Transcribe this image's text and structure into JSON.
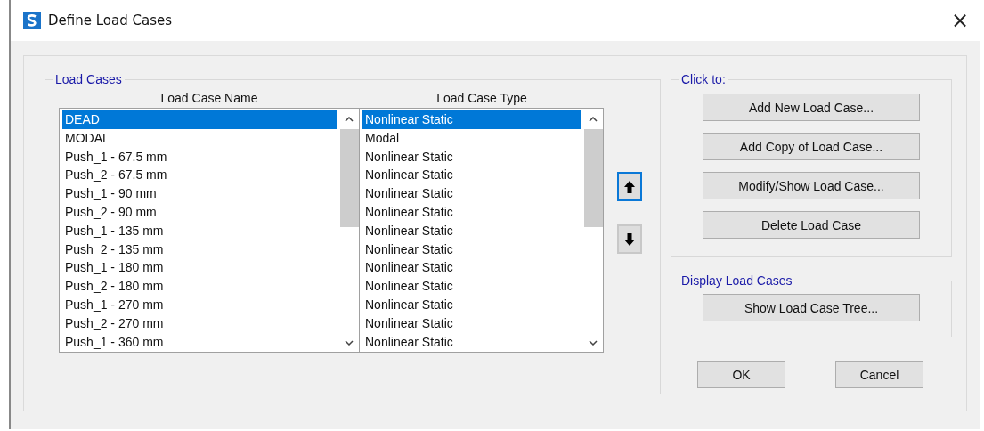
{
  "window": {
    "title": "Define Load Cases",
    "close": "×"
  },
  "load_cases": {
    "title": "Load Cases",
    "columns": [
      "Load Case Name",
      "Load Case Type"
    ],
    "rows": [
      {
        "name": "DEAD",
        "type": "Nonlinear Static",
        "selected": true
      },
      {
        "name": "MODAL",
        "type": "Modal",
        "selected": false
      },
      {
        "name": "Push_1 - 67.5 mm",
        "type": "Nonlinear Static",
        "selected": false
      },
      {
        "name": "Push_2 - 67.5 mm",
        "type": "Nonlinear Static",
        "selected": false
      },
      {
        "name": "Push_1 - 90 mm",
        "type": "Nonlinear Static",
        "selected": false
      },
      {
        "name": "Push_2 - 90 mm",
        "type": "Nonlinear Static",
        "selected": false
      },
      {
        "name": "Push_1 - 135 mm",
        "type": "Nonlinear Static",
        "selected": false
      },
      {
        "name": "Push_2 - 135 mm",
        "type": "Nonlinear Static",
        "selected": false
      },
      {
        "name": "Push_1 - 180 mm",
        "type": "Nonlinear Static",
        "selected": false
      },
      {
        "name": "Push_2 - 180 mm",
        "type": "Nonlinear Static",
        "selected": false
      },
      {
        "name": "Push_1 - 270 mm",
        "type": "Nonlinear Static",
        "selected": false
      },
      {
        "name": "Push_2 - 270 mm",
        "type": "Nonlinear Static",
        "selected": false
      },
      {
        "name": "Push_1 - 360 mm",
        "type": "Nonlinear Static",
        "selected": false
      }
    ],
    "move_buttons": [
      {
        "kind": "up",
        "focused": true
      },
      {
        "kind": "down",
        "focused": false
      }
    ]
  },
  "click_to": {
    "title": "Click to:",
    "buttons": [
      "Add New Load Case...",
      "Add Copy of Load Case...",
      "Modify/Show Load Case...",
      "Delete Load Case"
    ]
  },
  "display": {
    "title": "Display Load Cases",
    "buttons": [
      "Show Load Case Tree..."
    ]
  },
  "footer_buttons": [
    "OK",
    "Cancel"
  ]
}
